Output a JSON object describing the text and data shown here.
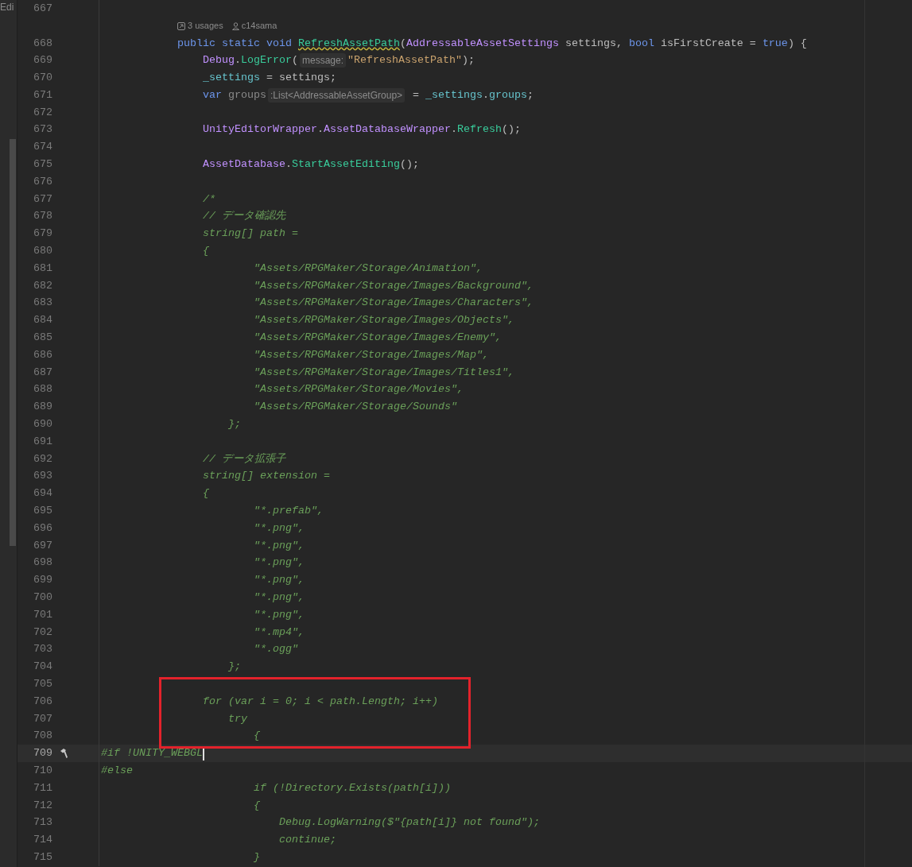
{
  "side_tab": {
    "label": "Edi"
  },
  "lines": [
    {
      "kind": "code",
      "number": "667",
      "current": false
    },
    {
      "kind": "inlay",
      "usages": "3 usages",
      "author": "c14sama"
    },
    {
      "kind": "code",
      "number": "668",
      "current": false,
      "tokens": [
        {
          "kind": "keyword",
          "text": "            public static void "
        },
        {
          "kind": "method-warning",
          "text": "RefreshAssetPath"
        },
        {
          "kind": "plain",
          "text": "("
        },
        {
          "kind": "type",
          "text": "AddressableAssetSettings"
        },
        {
          "kind": "plain",
          "text": " settings, "
        },
        {
          "kind": "keyword",
          "text": "bool"
        },
        {
          "kind": "plain",
          "text": " isFirstCreate = "
        },
        {
          "kind": "keyword",
          "text": "true"
        },
        {
          "kind": "plain",
          "text": ") {"
        }
      ]
    },
    {
      "kind": "code",
      "number": "669",
      "current": false,
      "tokens": [
        {
          "kind": "type",
          "text": "                Debug"
        },
        {
          "kind": "plain",
          "text": "."
        },
        {
          "kind": "method",
          "text": "LogError"
        },
        {
          "kind": "plain",
          "text": "("
        },
        {
          "kind": "hint",
          "text": "message:"
        },
        {
          "kind": "string",
          "text": "\"RefreshAssetPath\""
        },
        {
          "kind": "plain",
          "text": ");"
        }
      ]
    },
    {
      "kind": "code",
      "number": "670",
      "current": false,
      "tokens": [
        {
          "kind": "field",
          "text": "                _settings"
        },
        {
          "kind": "plain",
          "text": " = settings;"
        }
      ]
    },
    {
      "kind": "code",
      "number": "671",
      "current": false,
      "tokens": [
        {
          "kind": "keyword",
          "text": "                var"
        },
        {
          "kind": "unused",
          "text": " groups"
        },
        {
          "kind": "hint",
          "text": ":List<AddressableAssetGroup>"
        },
        {
          "kind": "plain",
          "text": " = "
        },
        {
          "kind": "field",
          "text": "_settings"
        },
        {
          "kind": "plain",
          "text": "."
        },
        {
          "kind": "field",
          "text": "groups"
        },
        {
          "kind": "plain",
          "text": ";"
        }
      ]
    },
    {
      "kind": "code",
      "number": "672",
      "current": false
    },
    {
      "kind": "code",
      "number": "673",
      "current": false,
      "tokens": [
        {
          "kind": "type",
          "text": "                UnityEditorWrapper"
        },
        {
          "kind": "plain",
          "text": "."
        },
        {
          "kind": "type",
          "text": "AssetDatabaseWrapper"
        },
        {
          "kind": "plain",
          "text": "."
        },
        {
          "kind": "method",
          "text": "Refresh"
        },
        {
          "kind": "plain",
          "text": "();"
        }
      ]
    },
    {
      "kind": "code",
      "number": "674",
      "current": false
    },
    {
      "kind": "code",
      "number": "675",
      "current": false,
      "tokens": [
        {
          "kind": "type",
          "text": "                AssetDatabase"
        },
        {
          "kind": "plain",
          "text": "."
        },
        {
          "kind": "method",
          "text": "StartAssetEditing"
        },
        {
          "kind": "plain",
          "text": "();"
        }
      ]
    },
    {
      "kind": "code",
      "number": "676",
      "current": false
    },
    {
      "kind": "code",
      "number": "677",
      "current": false,
      "tokens": [
        {
          "kind": "comment",
          "text": "                /*"
        }
      ]
    },
    {
      "kind": "code",
      "number": "678",
      "current": false,
      "tokens": [
        {
          "kind": "comment",
          "text": "                // データ確認先"
        }
      ]
    },
    {
      "kind": "code",
      "number": "679",
      "current": false,
      "tokens": [
        {
          "kind": "comment",
          "text": "                string[] path ="
        }
      ]
    },
    {
      "kind": "code",
      "number": "680",
      "current": false,
      "tokens": [
        {
          "kind": "comment",
          "text": "                {"
        }
      ]
    },
    {
      "kind": "code",
      "number": "681",
      "current": false,
      "tokens": [
        {
          "kind": "comment",
          "text": "                        \"Assets/RPGMaker/Storage/Animation\","
        }
      ]
    },
    {
      "kind": "code",
      "number": "682",
      "current": false,
      "tokens": [
        {
          "kind": "comment",
          "text": "                        \"Assets/RPGMaker/Storage/Images/Background\","
        }
      ]
    },
    {
      "kind": "code",
      "number": "683",
      "current": false,
      "tokens": [
        {
          "kind": "comment",
          "text": "                        \"Assets/RPGMaker/Storage/Images/Characters\","
        }
      ]
    },
    {
      "kind": "code",
      "number": "684",
      "current": false,
      "tokens": [
        {
          "kind": "comment",
          "text": "                        \"Assets/RPGMaker/Storage/Images/Objects\","
        }
      ]
    },
    {
      "kind": "code",
      "number": "685",
      "current": false,
      "tokens": [
        {
          "kind": "comment",
          "text": "                        \"Assets/RPGMaker/Storage/Images/Enemy\","
        }
      ]
    },
    {
      "kind": "code",
      "number": "686",
      "current": false,
      "tokens": [
        {
          "kind": "comment",
          "text": "                        \"Assets/RPGMaker/Storage/Images/Map\","
        }
      ]
    },
    {
      "kind": "code",
      "number": "687",
      "current": false,
      "tokens": [
        {
          "kind": "comment",
          "text": "                        \"Assets/RPGMaker/Storage/Images/Titles1\","
        }
      ]
    },
    {
      "kind": "code",
      "number": "688",
      "current": false,
      "tokens": [
        {
          "kind": "comment",
          "text": "                        \"Assets/RPGMaker/Storage/Movies\","
        }
      ]
    },
    {
      "kind": "code",
      "number": "689",
      "current": false,
      "tokens": [
        {
          "kind": "comment",
          "text": "                        \"Assets/RPGMaker/Storage/Sounds\""
        }
      ]
    },
    {
      "kind": "code",
      "number": "690",
      "current": false,
      "tokens": [
        {
          "kind": "comment",
          "text": "                    };"
        }
      ]
    },
    {
      "kind": "code",
      "number": "691",
      "current": false
    },
    {
      "kind": "code",
      "number": "692",
      "current": false,
      "tokens": [
        {
          "kind": "comment",
          "text": "                // データ拡張子"
        }
      ]
    },
    {
      "kind": "code",
      "number": "693",
      "current": false,
      "tokens": [
        {
          "kind": "comment",
          "text": "                string[] extension ="
        }
      ]
    },
    {
      "kind": "code",
      "number": "694",
      "current": false,
      "tokens": [
        {
          "kind": "comment",
          "text": "                {"
        }
      ]
    },
    {
      "kind": "code",
      "number": "695",
      "current": false,
      "tokens": [
        {
          "kind": "comment",
          "text": "                        \"*.prefab\","
        }
      ]
    },
    {
      "kind": "code",
      "number": "696",
      "current": false,
      "tokens": [
        {
          "kind": "comment",
          "text": "                        \"*.png\","
        }
      ]
    },
    {
      "kind": "code",
      "number": "697",
      "current": false,
      "tokens": [
        {
          "kind": "comment",
          "text": "                        \"*.png\","
        }
      ]
    },
    {
      "kind": "code",
      "number": "698",
      "current": false,
      "tokens": [
        {
          "kind": "comment",
          "text": "                        \"*.png\","
        }
      ]
    },
    {
      "kind": "code",
      "number": "699",
      "current": false,
      "tokens": [
        {
          "kind": "comment",
          "text": "                        \"*.png\","
        }
      ]
    },
    {
      "kind": "code",
      "number": "700",
      "current": false,
      "tokens": [
        {
          "kind": "comment",
          "text": "                        \"*.png\","
        }
      ]
    },
    {
      "kind": "code",
      "number": "701",
      "current": false,
      "tokens": [
        {
          "kind": "comment",
          "text": "                        \"*.png\","
        }
      ]
    },
    {
      "kind": "code",
      "number": "702",
      "current": false,
      "tokens": [
        {
          "kind": "comment",
          "text": "                        \"*.mp4\","
        }
      ]
    },
    {
      "kind": "code",
      "number": "703",
      "current": false,
      "tokens": [
        {
          "kind": "comment",
          "text": "                        \"*.ogg\""
        }
      ]
    },
    {
      "kind": "code",
      "number": "704",
      "current": false,
      "tokens": [
        {
          "kind": "comment",
          "text": "                    };"
        }
      ]
    },
    {
      "kind": "code",
      "number": "705",
      "current": false
    },
    {
      "kind": "code",
      "number": "706",
      "current": false,
      "tokens": [
        {
          "kind": "comment",
          "text": "                for (var i = 0; i < path.Length; i++)"
        }
      ]
    },
    {
      "kind": "code",
      "number": "707",
      "current": false,
      "tokens": [
        {
          "kind": "comment",
          "text": "                    try"
        }
      ]
    },
    {
      "kind": "code",
      "number": "708",
      "current": false,
      "tokens": [
        {
          "kind": "comment",
          "text": "                        {"
        }
      ]
    },
    {
      "kind": "code",
      "number": "709",
      "current": true,
      "tokens": [
        {
          "kind": "comment",
          "text": "#if !UNITY_WEBGL"
        }
      ]
    },
    {
      "kind": "code",
      "number": "710",
      "current": false,
      "tokens": [
        {
          "kind": "comment",
          "text": "#else"
        }
      ]
    },
    {
      "kind": "code",
      "number": "711",
      "current": false,
      "tokens": [
        {
          "kind": "comment",
          "text": "                        if (!Directory.Exists(path[i]))"
        }
      ]
    },
    {
      "kind": "code",
      "number": "712",
      "current": false,
      "tokens": [
        {
          "kind": "comment",
          "text": "                        {"
        }
      ]
    },
    {
      "kind": "code",
      "number": "713",
      "current": false,
      "tokens": [
        {
          "kind": "comment",
          "text": "                            Debug.LogWarning($\"{path[i]} not found\");"
        }
      ]
    },
    {
      "kind": "code",
      "number": "714",
      "current": false,
      "tokens": [
        {
          "kind": "comment",
          "text": "                            continue;"
        }
      ]
    },
    {
      "kind": "code",
      "number": "715",
      "current": false,
      "tokens": [
        {
          "kind": "comment",
          "text": "                        }"
        }
      ]
    }
  ]
}
